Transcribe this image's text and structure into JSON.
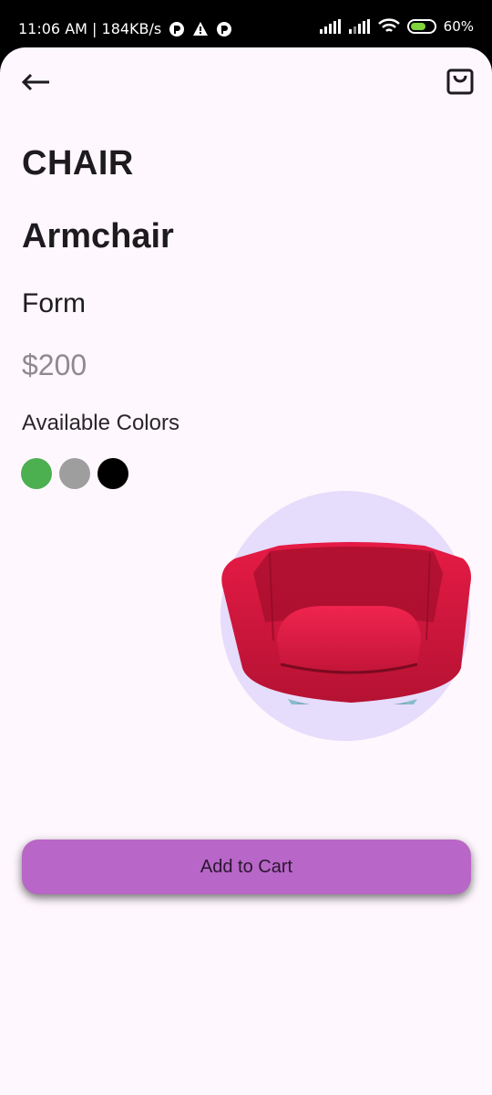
{
  "status_bar": {
    "time_network": "11:06 AM | 184KB/s",
    "battery": "60%"
  },
  "product": {
    "category": "CHAIR",
    "name": "Armchair",
    "brand": "Form",
    "price": "$200",
    "colors_label": "Available Colors",
    "colors": [
      "#4caf50",
      "#9e9e9e",
      "#000000"
    ]
  },
  "actions": {
    "add_to_cart": "Add to Cart"
  },
  "icons": {
    "back": "arrow-back-icon",
    "cart": "shopping-bag-icon"
  },
  "theme": {
    "background": "#fef7fd",
    "accent": "#b866c7",
    "hero_circle": "#e6dcfb",
    "chair_color": "#d8173f"
  }
}
